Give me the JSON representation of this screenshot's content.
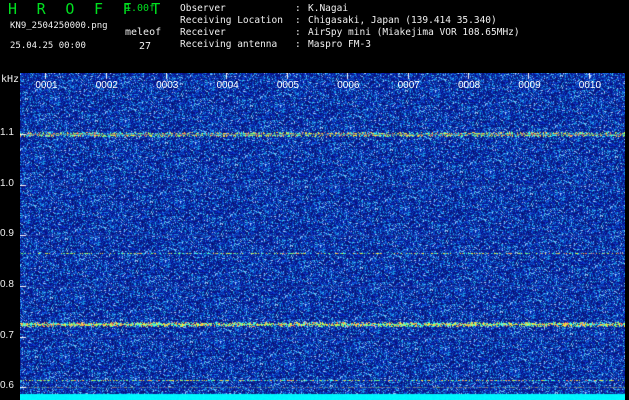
{
  "header": {
    "app_title": "H R O F F T",
    "app_version": "1.00f",
    "file_name": "KN9_2504250000.png",
    "meleof_label": "meleof",
    "date_time": "25.04.25 00:00",
    "meteor_count": "27"
  },
  "metadata": [
    {
      "label": "Observer",
      "value": "K.Nagai"
    },
    {
      "label": "Receiving Location",
      "value": "Chigasaki, Japan (139.414 35.340)"
    },
    {
      "label": "Receiver",
      "value": "AirSpy mini (Miakejima VOR 108.65MHz)"
    },
    {
      "label": "Receiving antenna",
      "value": "Maspro FM-3"
    }
  ],
  "spectrogram": {
    "y_unit": "kHz",
    "y_ticks": [
      "1.1",
      "1.0",
      "0.9",
      "0.8",
      "0.7",
      "0.6"
    ],
    "y_tick_values": [
      1.1,
      1.0,
      0.9,
      0.8,
      0.7,
      0.6
    ],
    "y_range": [
      0.575,
      1.22
    ],
    "x_ticks": [
      "0001",
      "0002",
      "0003",
      "0004",
      "0005",
      "0006",
      "0007",
      "0008",
      "0009",
      "0010"
    ],
    "x_tick_values": [
      1,
      2,
      3,
      4,
      5,
      6,
      7,
      8,
      9,
      10
    ],
    "x_range": [
      0.58,
      10.6
    ],
    "signal_lines_khz": [
      1.1,
      0.865,
      0.725,
      0.615,
      0.6
    ],
    "colors": {
      "background_noise": "#0b2a8e",
      "bright_noise": "#3fa0ff",
      "grid": "#1e2f80",
      "tick_label": "#f0f0f0",
      "header_green": "#00e020",
      "baseline": "#00ffff"
    }
  }
}
